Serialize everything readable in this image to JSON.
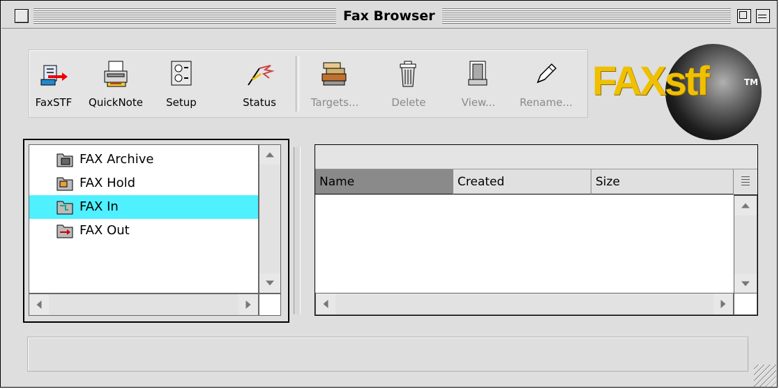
{
  "window": {
    "title": "Fax Browser"
  },
  "toolbar": {
    "items": [
      {
        "label": "FaxSTF",
        "icon": "faxstf-icon",
        "enabled": true
      },
      {
        "label": "QuickNote",
        "icon": "quicknote-icon",
        "enabled": true
      },
      {
        "label": "Setup",
        "icon": "setup-icon",
        "enabled": true
      },
      {
        "label": "Status",
        "icon": "status-icon",
        "enabled": true
      },
      {
        "label": "Targets...",
        "icon": "targets-icon",
        "enabled": false
      },
      {
        "label": "Delete",
        "icon": "trash-icon",
        "enabled": false
      },
      {
        "label": "View...",
        "icon": "view-icon",
        "enabled": false
      },
      {
        "label": "Rename...",
        "icon": "pencil-icon",
        "enabled": false
      }
    ]
  },
  "logo": {
    "text": "FAXstf",
    "tm": "TM",
    "color": "#f0c000"
  },
  "folders": {
    "items": [
      {
        "label": "FAX Archive",
        "icon": "archive-folder-icon",
        "selected": false
      },
      {
        "label": "FAX Hold",
        "icon": "hold-folder-icon",
        "selected": false
      },
      {
        "label": "FAX In",
        "icon": "inbox-folder-icon",
        "selected": true
      },
      {
        "label": "FAX Out",
        "icon": "outbox-folder-icon",
        "selected": false
      }
    ],
    "selected_color": "#4ff0ff"
  },
  "file_list": {
    "columns": [
      {
        "label": "Name",
        "sorted": true
      },
      {
        "label": "Created",
        "sorted": false
      },
      {
        "label": "Size",
        "sorted": false
      }
    ],
    "rows": []
  },
  "status": {
    "text": ""
  }
}
